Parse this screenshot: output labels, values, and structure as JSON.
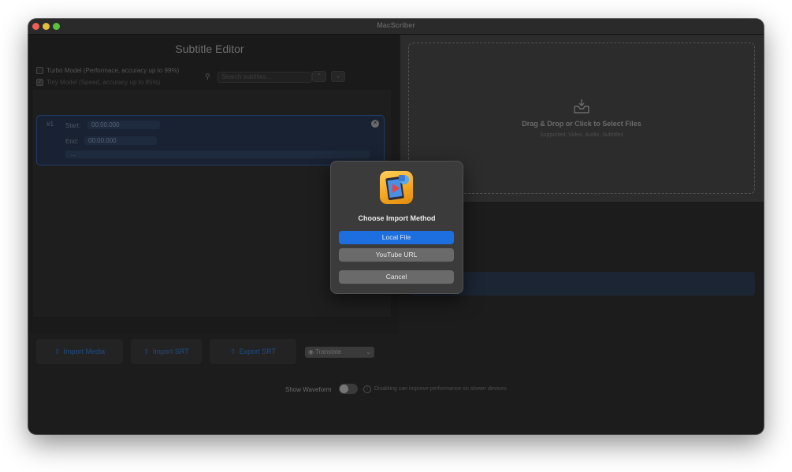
{
  "window": {
    "title": "MacScriber"
  },
  "editor": {
    "title": "Subtitle Editor",
    "turbo_model_label": "Turbo Model (Performace, accuracy up to 99%)",
    "tiny_model_label": "Tiny Model (Speed, accuracy up to 85%)",
    "search_placeholder": "Search subtitles...",
    "subtitle": {
      "number": "#1",
      "start_label": "Start:",
      "start_value": "00:00.000",
      "end_label": "End:",
      "end_value": "00:00.000",
      "text": "..."
    }
  },
  "drop_zone": {
    "title": "Drag & Drop or Click to Select Files",
    "subtitle": "Supported: Video, Audio, Subtitles"
  },
  "toolbar": {
    "import_media_label": "Import Media",
    "import_srt_label": "Import SRT",
    "export_srt_label": "Export SRT",
    "translate_label": "Translate"
  },
  "waveform": {
    "label": "Show Waveform",
    "hint": "Disabling can improve performance on slower devices",
    "enabled": false
  },
  "dialog": {
    "title": "Choose Import Method",
    "local_file_label": "Local File",
    "youtube_url_label": "YouTube URL",
    "cancel_label": "Cancel"
  },
  "colors": {
    "accent": "#1d6fe0",
    "window_bg": "#1c1c1c",
    "dialog_bg": "#3b3b3b",
    "app_icon": "#f3a51e"
  }
}
